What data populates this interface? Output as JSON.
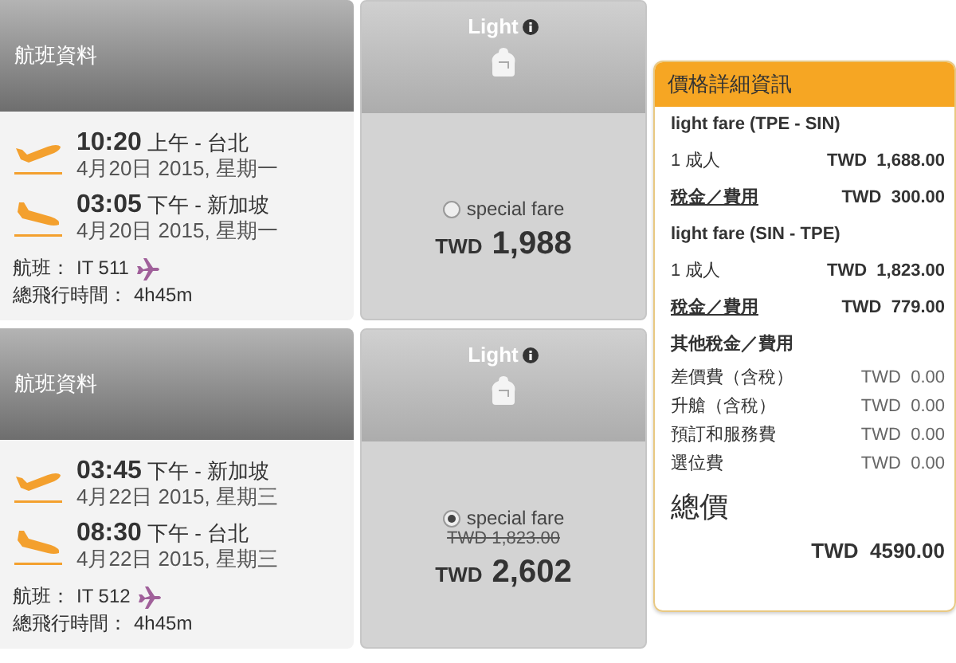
{
  "flights": [
    {
      "header": "航班資料",
      "segments": [
        {
          "kind": "depart",
          "time": "10:20",
          "period": "上午",
          "city": "- 台北",
          "date": "4月20日 2015, 星期一"
        },
        {
          "kind": "arrive",
          "time": "03:05",
          "period": "下午",
          "city": "- 新加坡",
          "date": "4月20日 2015, 星期一"
        }
      ],
      "flight_label": "航班：",
      "flight_number": "IT 511",
      "duration_label": "總飛行時間：",
      "duration": "4h45m",
      "fare": {
        "name": "Light",
        "option": "special fare",
        "selected": false,
        "currency": "TWD",
        "price": "1,988"
      }
    },
    {
      "header": "航班資料",
      "segments": [
        {
          "kind": "depart",
          "time": "03:45",
          "period": "下午",
          "city": "- 新加坡",
          "date": "4月22日 2015, 星期三"
        },
        {
          "kind": "arrive",
          "time": "08:30",
          "period": "下午",
          "city": "- 台北",
          "date": "4月22日 2015, 星期三"
        }
      ],
      "flight_label": "航班：",
      "flight_number": "IT 512",
      "duration_label": "總飛行時間：",
      "duration": "4h45m",
      "fare": {
        "name": "Light",
        "option": "special fare",
        "selected": true,
        "old_price": "TWD 1,823.00",
        "currency": "TWD",
        "price": "2,602"
      }
    }
  ],
  "price_panel": {
    "title": "價格詳細資訊",
    "rows": [
      {
        "kind": "heading",
        "label": "light fare (TPE - SIN)"
      },
      {
        "kind": "line",
        "label": "1 成人",
        "amount": "TWD  1,688.00"
      },
      {
        "kind": "link",
        "label": "稅金／費用",
        "amount": "TWD  300.00"
      },
      {
        "kind": "heading",
        "label": "light fare (SIN - TPE)"
      },
      {
        "kind": "line",
        "label": "1 成人",
        "amount": "TWD  1,823.00"
      },
      {
        "kind": "link",
        "label": "稅金／費用",
        "amount": "TWD  779.00"
      },
      {
        "kind": "heading",
        "label": "其他稅金／費用"
      },
      {
        "kind": "minor",
        "label": "差價費（含稅）",
        "amount": "TWD  0.00"
      },
      {
        "kind": "minor",
        "label": "升艙（含稅）",
        "amount": "TWD  0.00"
      },
      {
        "kind": "minor",
        "label": "預訂和服務費",
        "amount": "TWD  0.00"
      },
      {
        "kind": "minor",
        "label": "選位費",
        "amount": "TWD  0.00"
      }
    ],
    "total_label": "總價",
    "total": "TWD  4590.00"
  }
}
